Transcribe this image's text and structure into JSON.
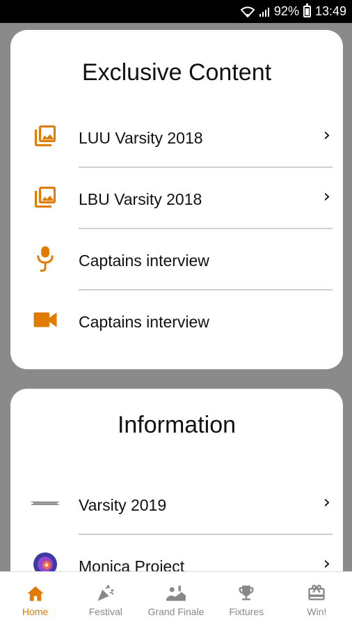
{
  "status_bar": {
    "battery": "92%",
    "time": "13:49"
  },
  "colors": {
    "accent": "#e07b00",
    "inactive": "#888888"
  },
  "exclusive": {
    "title": "Exclusive Content",
    "items": [
      {
        "icon": "photo-library-icon",
        "label": "LUU Varsity 2018",
        "has_chevron": true
      },
      {
        "icon": "photo-library-icon",
        "label": "LBU Varsity 2018",
        "has_chevron": true
      },
      {
        "icon": "microphone-icon",
        "label": "Captains interview",
        "has_chevron": false
      },
      {
        "icon": "videocam-icon",
        "label": "Captains interview",
        "has_chevron": false
      }
    ]
  },
  "information": {
    "title": "Information",
    "items": [
      {
        "icon": "leeds-varsity-logo",
        "label": "Varsity 2019",
        "has_chevron": true
      },
      {
        "icon": "monica-project-logo",
        "label": "Monica Project",
        "has_chevron": true
      }
    ]
  },
  "nav": {
    "items": [
      {
        "icon": "home-icon",
        "label": "Home",
        "active": true
      },
      {
        "icon": "party-popper-icon",
        "label": "Festival",
        "active": false
      },
      {
        "icon": "grand-finale-icon",
        "label": "Grand Finale",
        "active": false
      },
      {
        "icon": "trophy-icon",
        "label": "Fixtures",
        "active": false
      },
      {
        "icon": "gift-icon",
        "label": "Win!",
        "active": false
      }
    ]
  }
}
